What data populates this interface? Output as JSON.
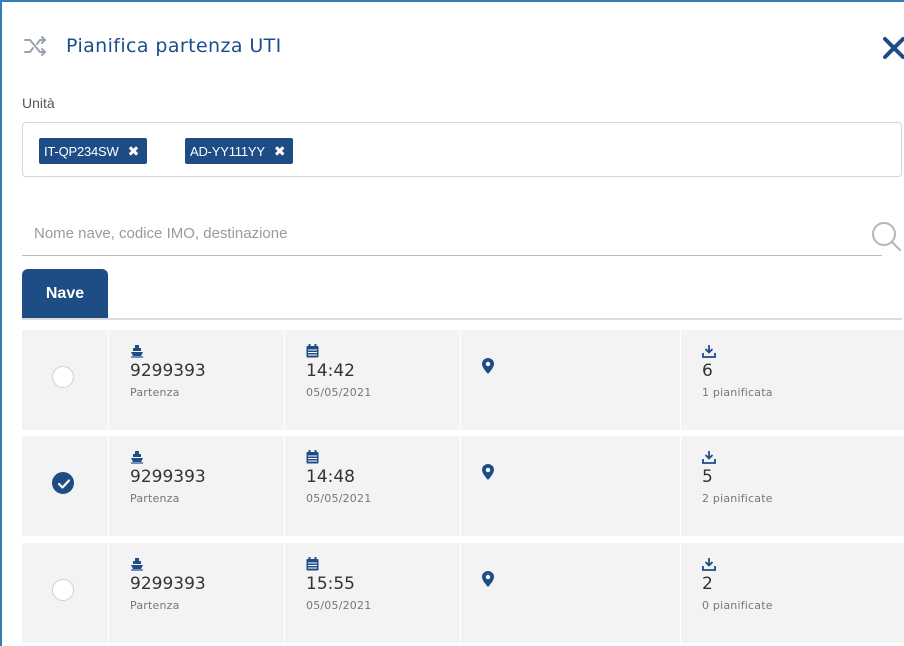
{
  "dialog": {
    "title": "Pianifica partenza UTI",
    "accent_color": "#1e4d86"
  },
  "units": {
    "label": "Unità",
    "chips": [
      {
        "label": "IT-QP234SW"
      },
      {
        "label": "AD-YY111YY"
      }
    ]
  },
  "search": {
    "placeholder": "Nome nave, codice IMO, destinazione",
    "value": ""
  },
  "tabs": [
    {
      "label": "Nave",
      "active": true
    }
  ],
  "departures": [
    {
      "selected": false,
      "imo": "9299393",
      "imo_caption": "Partenza",
      "time": "14:42",
      "date": "05/05/2021",
      "count": "6",
      "planned": "1 pianificata"
    },
    {
      "selected": true,
      "imo": "9299393",
      "imo_caption": "Partenza",
      "time": "14:48",
      "date": "05/05/2021",
      "count": "5",
      "planned": "2 pianificate"
    },
    {
      "selected": false,
      "imo": "9299393",
      "imo_caption": "Partenza",
      "time": "15:55",
      "date": "05/05/2021",
      "count": "2",
      "planned": "0 pianificate"
    }
  ],
  "icons": {
    "header": "shuffle-icon",
    "close": "close-icon",
    "search": "search-icon",
    "vessel": "ship-icon",
    "date": "calendar-icon",
    "destination": "map-pin-icon",
    "units": "download-icon",
    "selected": "check-icon"
  }
}
